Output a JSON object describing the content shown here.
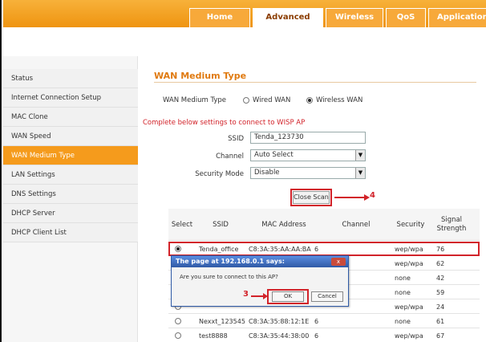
{
  "nav": {
    "tabs": [
      {
        "label": "Home"
      },
      {
        "label": "Advanced"
      },
      {
        "label": "Wireless"
      },
      {
        "label": "QoS"
      },
      {
        "label": "Applications"
      }
    ],
    "active_tab": "Advanced"
  },
  "sidebar": {
    "items": [
      {
        "label": "Status"
      },
      {
        "label": "Internet Connection Setup"
      },
      {
        "label": "MAC Clone"
      },
      {
        "label": "WAN Speed"
      },
      {
        "label": "WAN Medium Type"
      },
      {
        "label": "LAN Settings"
      },
      {
        "label": "DNS Settings"
      },
      {
        "label": "DHCP Server"
      },
      {
        "label": "DHCP Client List"
      }
    ],
    "active_item": "WAN Medium Type"
  },
  "page": {
    "title": "WAN Medium Type",
    "medium_label": "WAN Medium Type",
    "wired_label": "Wired WAN",
    "wireless_label": "Wireless WAN",
    "selected_medium": "Wireless WAN",
    "note": "Complete below settings to connect to WISP AP",
    "ssid_label": "SSID",
    "ssid_value": "Tenda_123730",
    "channel_label": "Channel",
    "channel_value": "Auto Select",
    "security_label": "Security Mode",
    "security_value": "Disable",
    "close_scan": "Close Scan",
    "annotation_4": "4"
  },
  "scan_table": {
    "headers": {
      "select": "Select",
      "ssid": "SSID",
      "mac": "MAC Address",
      "channel": "Channel",
      "security": "Security",
      "signal_1": "Signal",
      "signal_2": "Strength"
    },
    "rows": [
      {
        "ssid": "Tenda_office",
        "mac": "C8:3A:35:AA:AA:BA",
        "channel": "6",
        "security": "wep/wpa",
        "signal": "76",
        "selected": true
      },
      {
        "ssid": "",
        "mac": "",
        "channel": "",
        "security": "wep/wpa",
        "signal": "62",
        "selected": false
      },
      {
        "ssid": "",
        "mac": "",
        "channel": "",
        "security": "none",
        "signal": "42",
        "selected": false
      },
      {
        "ssid": "",
        "mac": "",
        "channel": "",
        "security": "none",
        "signal": "59",
        "selected": false
      },
      {
        "ssid": "",
        "mac": "",
        "channel": "",
        "security": "wep/wpa",
        "signal": "24",
        "selected": false
      },
      {
        "ssid": "Nexxt_123545",
        "mac": "C8:3A:35:88:12:1E",
        "channel": "6",
        "security": "none",
        "signal": "61",
        "selected": false
      },
      {
        "ssid": "test8888",
        "mac": "C8:3A:35:44:38:00",
        "channel": "6",
        "security": "wep/wpa",
        "signal": "67",
        "selected": false
      }
    ]
  },
  "dialog": {
    "title": "The page at 192.168.0.1 says:",
    "close": "x",
    "message": "Are you sure to connect to this AP?",
    "ok": "OK",
    "cancel": "Cancel",
    "annotation_3": "3"
  },
  "colors": {
    "accent_orange": "#f59b1c",
    "annotation_red": "#d2232a",
    "dialog_blue": "#2f5aa6"
  }
}
